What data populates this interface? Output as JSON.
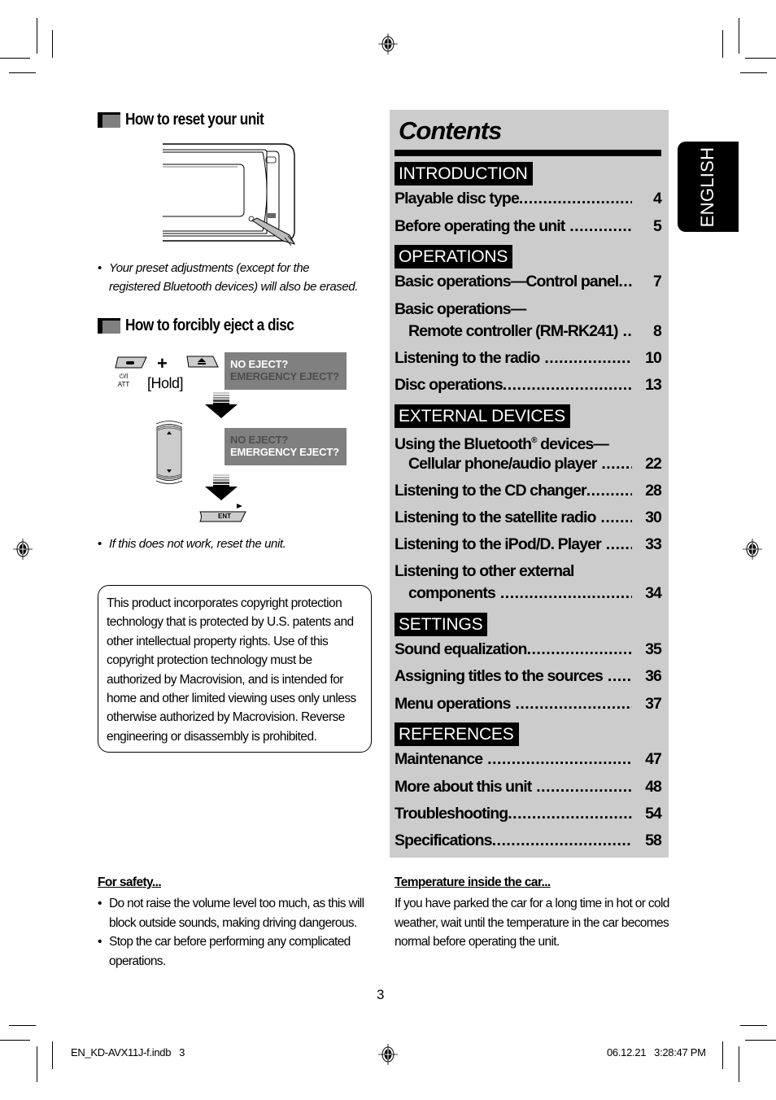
{
  "reset_section": {
    "title": "How to reset your unit",
    "note": "Your preset adjustments (except for the registered Bluetooth devices) will also be erased."
  },
  "eject_section": {
    "title": "How to forcibly eject a disc",
    "button_att_label": "⏻/I ATT",
    "plus": "+",
    "hold_label": "[Hold]",
    "display1": {
      "line1": "NO EJECT?",
      "line2": "EMERGENCY EJECT?",
      "highlighted": "line1"
    },
    "display2": {
      "line1": "NO EJECT?",
      "line2": "EMERGENCY EJECT?",
      "highlighted": "line2"
    },
    "ent_label": "ENT",
    "note": "If this does not work, reset the unit."
  },
  "copyright_notice": "This product incorporates copyright protection technology that is protected by U.S. patents and other intellectual property rights. Use of this copyright protection technology must be authorized by Macrovision, and is intended for home and other limited viewing uses only unless otherwise authorized by Macrovision. Reverse engineering or disassembly is prohibited.",
  "contents": {
    "title": "Contents",
    "sections": [
      {
        "name": "INTRODUCTION",
        "items": [
          {
            "label": "Playable disc type",
            "page": "4"
          },
          {
            "label": "Before operating the unit",
            "page": "5"
          }
        ]
      },
      {
        "name": "OPERATIONS",
        "items": [
          {
            "label": "Basic operations—Control panel",
            "page": "7"
          },
          {
            "label_line1": "Basic operations—",
            "label": "Remote controller (RM-RK241)",
            "page": "8"
          },
          {
            "label": "Listening to the radio",
            "page": "10"
          },
          {
            "label": "Disc operations",
            "page": "13"
          }
        ]
      },
      {
        "name": "EXTERNAL DEVICES",
        "items": [
          {
            "label_line1": "Using the Bluetooth® devices—",
            "label": "Cellular phone/audio player",
            "page": "22"
          },
          {
            "label": "Listening to the CD changer",
            "page": "28"
          },
          {
            "label": "Listening to the satellite radio",
            "page": "30"
          },
          {
            "label": "Listening to the iPod/D. Player",
            "page": "33"
          },
          {
            "label_line1": "Listening to other external",
            "label": "components",
            "page": "34"
          }
        ]
      },
      {
        "name": "SETTINGS",
        "items": [
          {
            "label": "Sound equalization",
            "page": "35"
          },
          {
            "label": "Assigning titles to the sources",
            "page": "36"
          },
          {
            "label": "Menu operations",
            "page": "37"
          }
        ]
      },
      {
        "name": "REFERENCES",
        "items": [
          {
            "label": "Maintenance",
            "page": "47"
          },
          {
            "label": "More about this unit",
            "page": "48"
          },
          {
            "label": "Troubleshooting",
            "page": "54"
          },
          {
            "label": "Specifications",
            "page": "58"
          }
        ]
      }
    ]
  },
  "language_tab": "ENGLISH",
  "safety": {
    "heading": "For safety...",
    "bullets": [
      "Do not raise the volume level too much, as this will block outside sounds, making driving dangerous.",
      "Stop the car before performing any complicated operations."
    ]
  },
  "temperature": {
    "heading": "Temperature inside the car...",
    "text": "If you have parked the car for a long time in hot or cold weather, wait until the temperature in the car becomes normal before operating the unit."
  },
  "page_number": "3",
  "footer": {
    "file": "EN_KD-AVX11J-f.indb   3",
    "timestamp": "06.12.21   3:28:47 PM"
  },
  "colors": {
    "panel_gray": "#cccccc",
    "display_gray": "#808080",
    "display_lit": "#ffffff",
    "display_dim": "#4d4d4d"
  }
}
